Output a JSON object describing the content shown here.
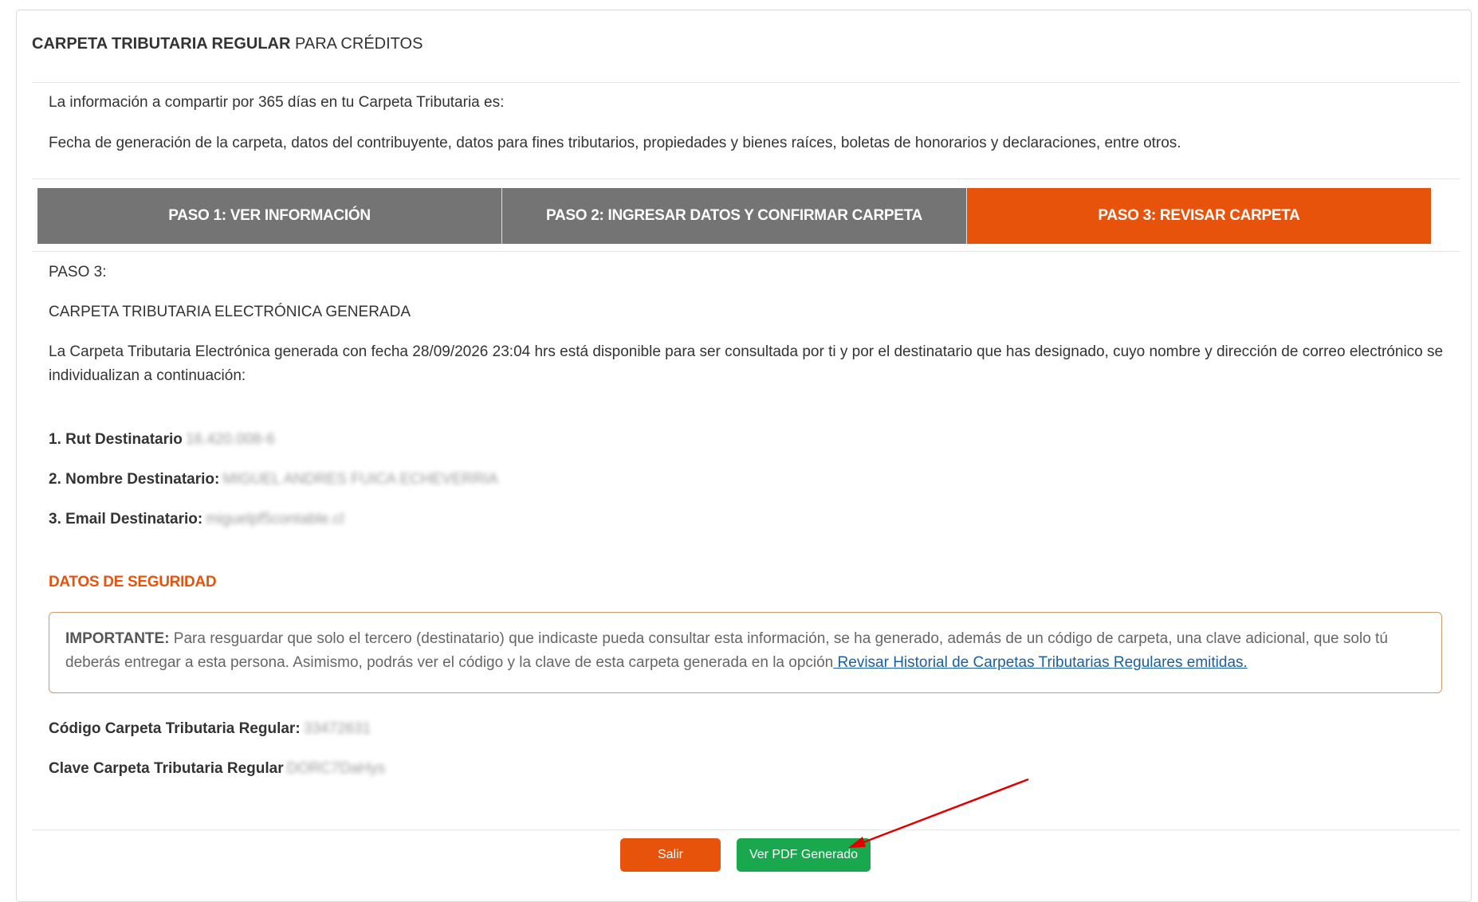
{
  "header": {
    "title_bold": "CARPETA TRIBUTARIA REGULAR",
    "title_rest": " PARA CRÉDITOS"
  },
  "intro": {
    "line1": "La información a compartir por 365 días en tu Carpeta Tributaria es:",
    "line2": "Fecha de generación de la carpeta, datos del contribuyente, datos para fines tributarios, propiedades y bienes raíces, boletas de honorarios y declaraciones, entre otros."
  },
  "steps": [
    {
      "label": "PASO 1: VER INFORMACIÓN",
      "active": false
    },
    {
      "label": "PASO 2: INGRESAR DATOS Y CONFIRMAR CARPETA",
      "active": false
    },
    {
      "label": "PASO 3: REVISAR CARPETA",
      "active": true
    }
  ],
  "step3": {
    "label": "PASO 3:",
    "subtitle": "CARPETA TRIBUTARIA ELECTRÓNICA GENERADA",
    "description": "La Carpeta Tributaria Electrónica generada con fecha 28/09/2026 23:04 hrs está disponible para ser consultada por ti y por el destinatario que has designado, cuyo nombre y dirección de correo electrónico se individualizan a continuación:"
  },
  "recipient": {
    "rut_label": "1. Rut Destinatario",
    "rut_value": "16.420.008-6",
    "name_label": "2. Nombre Destinatario:",
    "name_value": "MIGUEL ANDRES FUICA ECHEVERRIA",
    "email_label": "3. Email Destinatario:",
    "email_value": "miguelpf5contable.cl"
  },
  "security": {
    "title": "DATOS DE SEGURIDAD",
    "important_label": "IMPORTANTE:",
    "important_text": " Para resguardar que solo el tercero (destinatario) que indicaste pueda consultar esta información, se ha generado, además de un código de carpeta, una clave adicional, que solo tú deberás entregar a esta persona. Asimismo, podrás ver el código y la clave de esta carpeta generada en la opción",
    "link_text": " Revisar Historial de Carpetas Tributarias Regulares emitidas."
  },
  "codes": {
    "code_label": "Código Carpeta Tributaria Regular:",
    "code_value": "33472631",
    "key_label": "Clave Carpeta Tributaria Regular",
    "key_value": "DORC7DaHys"
  },
  "buttons": {
    "exit_label": "Salir",
    "pdf_label": "Ver PDF Generado"
  },
  "colors": {
    "accent": "#e8530b",
    "step_inactive": "#747474",
    "pdf_button": "#1aa84f",
    "link": "#1a5fa0",
    "annotation_arrow": "#e00000"
  }
}
